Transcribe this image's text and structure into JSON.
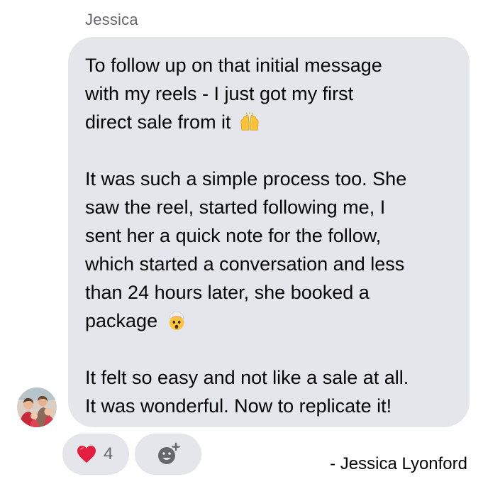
{
  "sender": {
    "name": "Jessica"
  },
  "message": {
    "paragraphs": [
      {
        "lines": [
          "To follow up on that initial message",
          "with my reels - I just got my first",
          "direct sale from it"
        ],
        "emoji": "raising-hands-emoji"
      },
      {
        "lines": [
          "It was such a simple process too. She",
          "saw the reel, started following me, I",
          "sent her a quick note for the follow,",
          "which started a conversation and less",
          "than 24 hours later, she booked a",
          "package"
        ],
        "emoji": "exploding-head-emoji"
      },
      {
        "lines": [
          "It felt so easy and not like a sale at all.",
          "It was wonderful. Now to replicate it!"
        ],
        "emoji": ""
      }
    ]
  },
  "reactions": {
    "heart_count": "4",
    "heart_icon": "heart-icon",
    "add_reaction_icon": "add-reaction-icon"
  },
  "attribution": {
    "text": "- Jessica Lyonford"
  },
  "colors": {
    "bubble": "#e4e6eb",
    "heart": "#e41e3f",
    "secondary_text": "#65676b"
  }
}
